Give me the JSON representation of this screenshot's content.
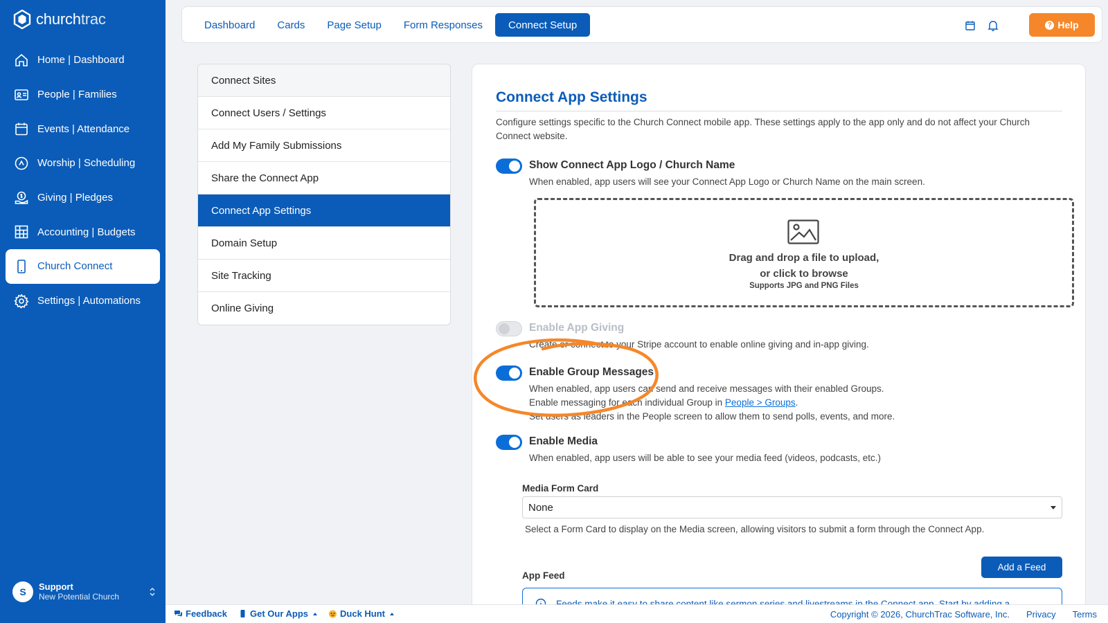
{
  "brand": {
    "name_main": "church",
    "name_sub": "trac"
  },
  "sidebar": {
    "items": [
      {
        "label": "Home | Dashboard",
        "icon": "home-icon"
      },
      {
        "label": "People | Families",
        "icon": "id-card-icon"
      },
      {
        "label": "Events | Attendance",
        "icon": "calendar-icon"
      },
      {
        "label": "Worship | Scheduling",
        "icon": "music-icon"
      },
      {
        "label": "Giving | Pledges",
        "icon": "giving-icon"
      },
      {
        "label": "Accounting | Budgets",
        "icon": "grid-icon"
      },
      {
        "label": "Church Connect",
        "icon": "phone-icon",
        "active": true
      },
      {
        "label": "Settings | Automations",
        "icon": "gear-icon"
      }
    ],
    "user": {
      "initial": "S",
      "name": "Support",
      "org": "New Potential Church"
    }
  },
  "topbar": {
    "tabs": [
      "Dashboard",
      "Cards",
      "Page Setup",
      "Form Responses",
      "Connect Setup"
    ],
    "active_tab": "Connect Setup",
    "help_label": "Help"
  },
  "submenu": {
    "items": [
      "Connect Sites",
      "Connect Users / Settings",
      "Add My Family Submissions",
      "Share the Connect App",
      "Connect App Settings",
      "Domain Setup",
      "Site Tracking",
      "Online Giving"
    ],
    "active": "Connect App Settings"
  },
  "main": {
    "title": "Connect App Settings",
    "description": "Configure settings specific to the Church Connect mobile app. These settings apply to the app only and do not affect your Church Connect website.",
    "logo_setting": {
      "label": "Show Connect App Logo / Church Name",
      "desc": "When enabled, app users will see your Connect App Logo or Church Name on the main screen.",
      "enabled": true
    },
    "dropzone": {
      "line1": "Drag and drop a file to upload,",
      "line2": "or click to browse",
      "sub": "Supports JPG and PNG Files"
    },
    "giving_setting": {
      "label": "Enable App Giving",
      "desc": "Create or connect to your Stripe account to enable online giving and in-app giving.",
      "enabled": false
    },
    "group_setting": {
      "label": "Enable Group Messages",
      "desc1": "When enabled, app users can send and receive messages with their enabled Groups.",
      "desc2_pre": "Enable messaging for each individual Group in ",
      "desc2_link": "People > Groups",
      "desc2_post": ".",
      "desc3": "Set users as leaders in the People screen to allow them to send polls, events, and more.",
      "enabled": true
    },
    "media_setting": {
      "label": "Enable Media",
      "desc": "When enabled, app users will be able to see your media feed (videos, podcasts, etc.)",
      "enabled": true
    },
    "media_form": {
      "label": "Media Form Card",
      "value": "None",
      "help": "Select a Form Card to display on the Media screen, allowing visitors to submit a form through the Connect App."
    },
    "app_feed": {
      "label": "App Feed",
      "add_label": "Add a Feed",
      "info": "Feeds make it easy to share content like sermon series and livestreams in the Connect app. Start by adding a"
    }
  },
  "footer": {
    "feedback": "Feedback",
    "apps": "Get Our Apps",
    "duck": "Duck Hunt",
    "copyright": "Copyright © 2026, ChurchTrac Software, Inc.",
    "privacy": "Privacy",
    "terms": "Terms"
  },
  "colors": {
    "primary": "#0b5cb8",
    "accent": "#f5872a",
    "annotation": "#f5872a"
  }
}
